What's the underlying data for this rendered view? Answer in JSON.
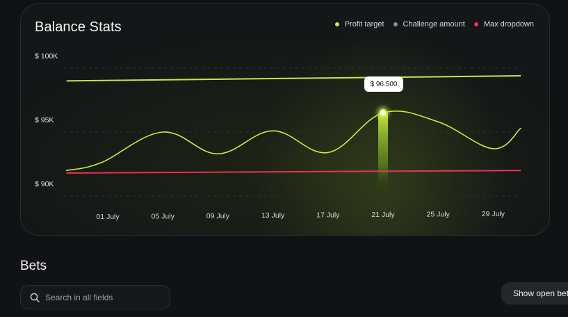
{
  "card": {
    "title": "Balance Stats",
    "legend": [
      {
        "label": "Profit target",
        "color": "#c8f03a"
      },
      {
        "label": "Challenge amount",
        "color": "#8a8d90"
      },
      {
        "label": "Max dropdown",
        "color": "#ff2d4f"
      }
    ]
  },
  "chart_data": {
    "type": "line",
    "y_ticks": [
      "$ 100K",
      "$ 95K",
      "$ 90K"
    ],
    "ylim": [
      90000,
      100000
    ],
    "categories": [
      "01 July",
      "05 July",
      "09 July",
      "13 July",
      "17 July",
      "21 July",
      "25 July",
      "29 July"
    ],
    "x_days": [
      1,
      5,
      9,
      13,
      17,
      21,
      25,
      29
    ],
    "series": [
      {
        "name": "Challenge amount",
        "color": "#c8f03a",
        "days": [
          -2,
          0.5,
          5,
          9,
          13,
          17,
          21,
          25,
          29,
          31
        ],
        "values": [
          92000,
          92600,
          95000,
          93300,
          95100,
          93400,
          96500,
          95800,
          93700,
          95300
        ]
      },
      {
        "name": "Profit target",
        "color": "#c6e84a",
        "days": [
          -2,
          31
        ],
        "values": [
          99000,
          99400
        ]
      },
      {
        "name": "Max dropdown",
        "color": "#e8344f",
        "days": [
          -2,
          31
        ],
        "values": [
          91800,
          92000
        ]
      }
    ],
    "highlight": {
      "day": 21,
      "value": 96500,
      "label": "$ 96.500"
    },
    "grid": "dashed-horizontal"
  },
  "bets": {
    "title": "Bets",
    "search_placeholder": "Search in all fields",
    "show_open_label": "Show open bets"
  }
}
